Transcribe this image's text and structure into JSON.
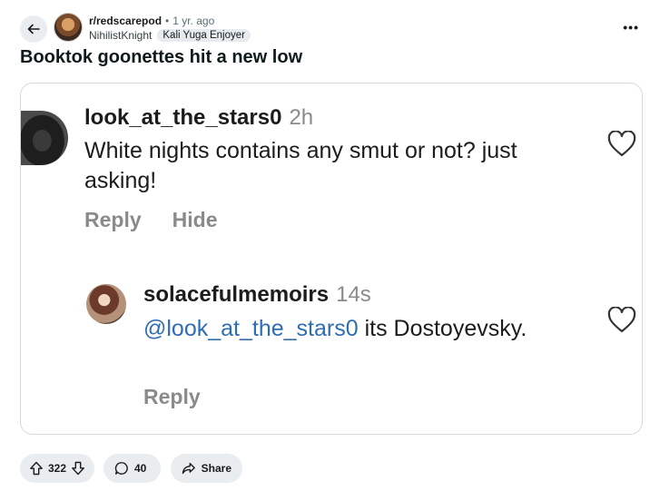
{
  "header": {
    "subreddit": "r/redscarepod",
    "separator": "•",
    "time_ago": "1 yr. ago",
    "username": "NihilistKnight",
    "user_flair": "Kali Yuga Enjoyer",
    "more_label": "•••"
  },
  "post": {
    "title": "Booktok goonettes hit a new low"
  },
  "screenshot": {
    "comment": {
      "user": "look_at_the_stars0",
      "time": "2h",
      "text": "White nights contains any smut or not? just asking!",
      "reply_label": "Reply",
      "hide_label": "Hide"
    },
    "reply": {
      "user": "solacefulmemoirs",
      "time": "14s",
      "mention": "@look_at_the_stars0",
      "text": " its Dostoyevsky.",
      "reply_label": "Reply"
    }
  },
  "actions": {
    "vote_count": "322",
    "comment_count": "40",
    "share_label": "Share"
  },
  "icons": {
    "back": "arrow-left-icon",
    "like": "heart-icon",
    "upvote": "upvote-arrow-icon",
    "downvote": "downvote-arrow-icon",
    "comment": "speech-bubble-icon",
    "share": "share-arrow-icon"
  },
  "colors": {
    "mention": "#2f6db3",
    "pill_bg": "#eaedef",
    "muted_text": "#8a8a8a"
  }
}
